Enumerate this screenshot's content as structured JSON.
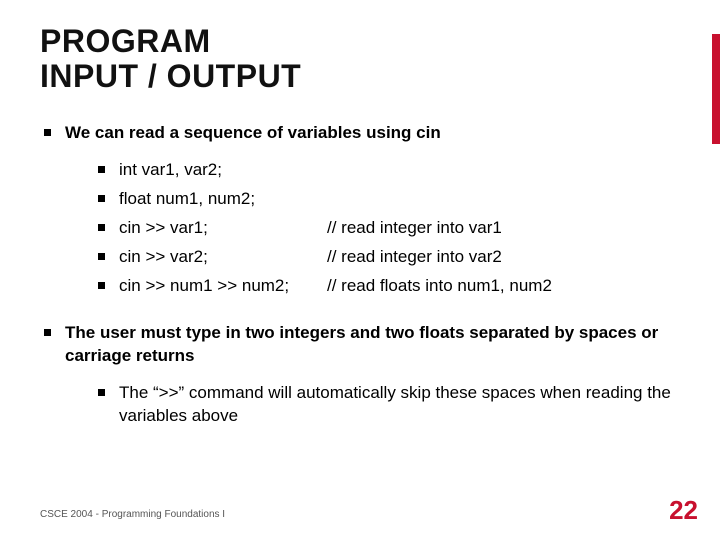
{
  "title_line1": "PROGRAM",
  "title_line2": "INPUT / OUTPUT",
  "bullets": {
    "b1": "We can read a sequence of variables using cin",
    "code": [
      {
        "stmt": "int var1, var2;",
        "comment": ""
      },
      {
        "stmt": "float num1, num2;",
        "comment": ""
      },
      {
        "stmt": "cin >> var1;",
        "comment": "// read integer into var1"
      },
      {
        "stmt": "cin >> var2;",
        "comment": "// read integer into var2"
      },
      {
        "stmt": "cin >> num1 >> num2;",
        "comment": "// read floats into num1, num2"
      }
    ],
    "b2": "The user must type in two integers and two floats separated by spaces or carriage returns",
    "b2_sub": "The “>>” command will automatically skip these spaces when reading the variables above"
  },
  "footer": "CSCE 2004 - Programming Foundations I",
  "page_num": "22"
}
